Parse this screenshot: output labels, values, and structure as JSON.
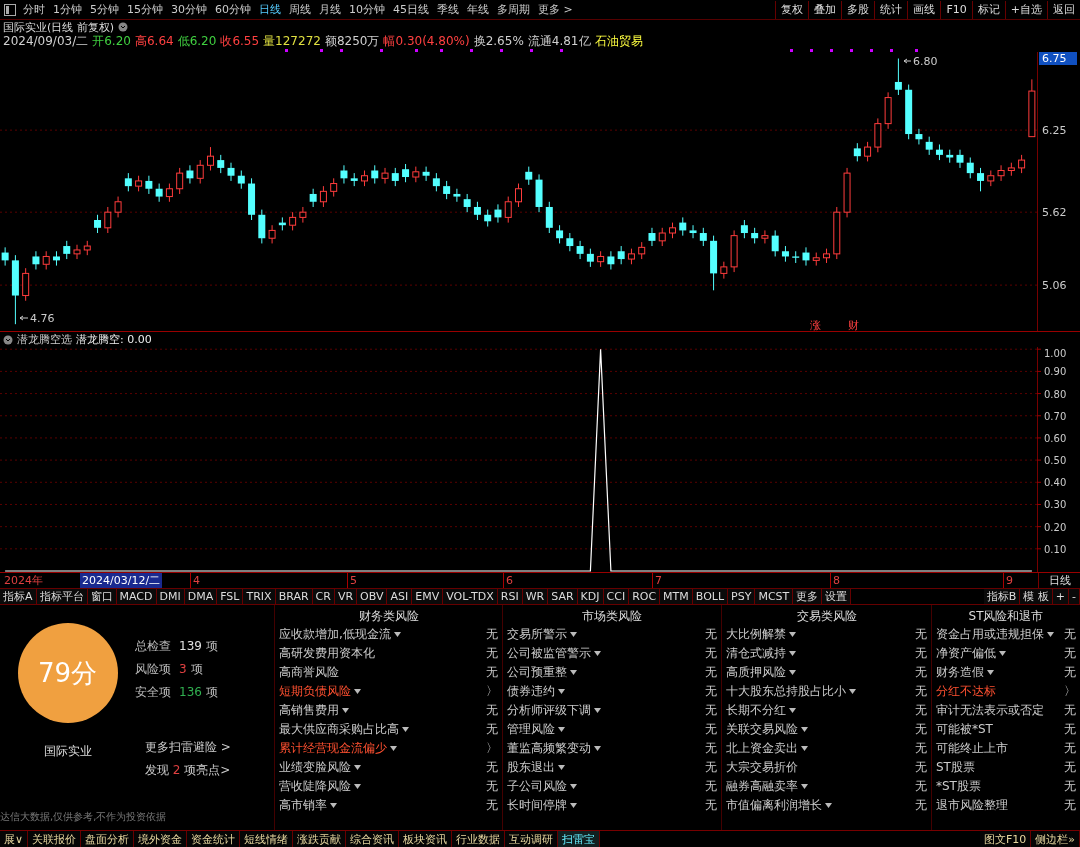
{
  "toolbar": {
    "periods": [
      {
        "label": "分时",
        "selected": false
      },
      {
        "label": "1分钟",
        "selected": false
      },
      {
        "label": "5分钟",
        "selected": false
      },
      {
        "label": "15分钟",
        "selected": false
      },
      {
        "label": "30分钟",
        "selected": false
      },
      {
        "label": "60分钟",
        "selected": false
      },
      {
        "label": "日线",
        "selected": true
      },
      {
        "label": "周线",
        "selected": false
      },
      {
        "label": "月线",
        "selected": false
      },
      {
        "label": "10分钟",
        "selected": false
      },
      {
        "label": "45日线",
        "selected": false
      },
      {
        "label": "季线",
        "selected": false
      },
      {
        "label": "年线",
        "selected": false
      },
      {
        "label": "多周期",
        "selected": false
      },
      {
        "label": "更多 >",
        "selected": false
      }
    ],
    "buttons": [
      "复权",
      "叠加",
      "多股",
      "统计",
      "画线",
      "F10",
      "标记",
      "+自选",
      "返回"
    ]
  },
  "stock": {
    "title": "国际实业(日线 前复权)",
    "quote": [
      {
        "text": "2024/09/03/二",
        "color": "#d0d0d0"
      },
      {
        "text": "开6.20",
        "color": "#40d040"
      },
      {
        "text": "高6.64",
        "color": "#ff4040"
      },
      {
        "text": "低6.20",
        "color": "#40d040"
      },
      {
        "text": "收6.55",
        "color": "#ff4040"
      },
      {
        "text": "量127272",
        "color": "#e0e040"
      },
      {
        "text": "额8250万",
        "color": "#d0d0d0"
      },
      {
        "text": "幅0.30(4.80%)",
        "color": "#ff4040"
      },
      {
        "text": "换2.65%",
        "color": "#d0d0d0"
      },
      {
        "text": "流通4.81亿",
        "color": "#d0d0d0"
      },
      {
        "text": "石油贸易",
        "color": "#ffff40"
      }
    ]
  },
  "price_chart": {
    "top_label": "6.75",
    "high_mark": "6.80",
    "low_mark": "4.76",
    "event_marks": [
      "涨",
      "财"
    ],
    "chart_data": {
      "type": "candlestick",
      "grid": true,
      "ylim": [
        4.7,
        6.85
      ],
      "yticks": [
        6.25,
        5.62,
        5.06
      ],
      "categories": [
        null,
        null,
        null,
        null,
        null,
        null,
        null,
        null,
        null,
        null,
        null,
        null,
        null,
        null,
        null,
        null,
        null,
        null,
        null,
        null,
        null,
        null,
        null,
        null,
        null,
        null,
        null,
        null,
        null,
        null,
        null,
        null,
        null,
        null,
        null,
        null,
        null,
        null,
        null,
        null,
        null,
        null,
        null,
        null,
        null,
        null,
        null,
        null,
        null,
        null,
        null,
        null,
        null,
        null,
        null,
        null,
        null,
        null,
        null,
        null,
        null,
        null,
        null,
        null,
        null,
        null,
        null,
        null,
        null,
        null,
        null,
        null,
        null,
        null,
        null,
        null,
        null,
        null,
        null,
        null,
        null,
        null,
        null,
        null,
        null,
        null,
        null,
        null,
        null,
        null,
        null,
        null,
        null,
        null,
        null,
        null,
        null,
        null,
        null,
        null,
        null
      ],
      "ohlc": [
        [
          5.31,
          5.35,
          5.21,
          5.25
        ],
        [
          5.25,
          5.29,
          4.76,
          4.98
        ],
        [
          4.98,
          5.19,
          4.94,
          5.15
        ],
        [
          5.28,
          5.32,
          5.18,
          5.22
        ],
        [
          5.22,
          5.32,
          5.18,
          5.28
        ],
        [
          5.28,
          5.32,
          5.21,
          5.25
        ],
        [
          5.36,
          5.4,
          5.26,
          5.3
        ],
        [
          5.3,
          5.37,
          5.26,
          5.33
        ],
        [
          5.33,
          5.4,
          5.29,
          5.36
        ],
        [
          5.56,
          5.6,
          5.46,
          5.5
        ],
        [
          5.5,
          5.66,
          5.46,
          5.62
        ],
        [
          5.62,
          5.74,
          5.58,
          5.7
        ],
        [
          5.88,
          5.92,
          5.78,
          5.82
        ],
        [
          5.82,
          5.9,
          5.78,
          5.86
        ],
        [
          5.86,
          5.9,
          5.76,
          5.8
        ],
        [
          5.8,
          5.84,
          5.7,
          5.74
        ],
        [
          5.74,
          5.84,
          5.7,
          5.8
        ],
        [
          5.8,
          5.96,
          5.76,
          5.92
        ],
        [
          5.94,
          5.98,
          5.84,
          5.88
        ],
        [
          5.88,
          6.02,
          5.84,
          5.98
        ],
        [
          5.98,
          6.12,
          5.94,
          6.05
        ],
        [
          6.02,
          6.06,
          5.92,
          5.96
        ],
        [
          5.96,
          6.0,
          5.86,
          5.9
        ],
        [
          5.9,
          5.94,
          5.8,
          5.84
        ],
        [
          5.84,
          5.88,
          5.56,
          5.6
        ],
        [
          5.6,
          5.64,
          5.38,
          5.42
        ],
        [
          5.42,
          5.52,
          5.38,
          5.48
        ],
        [
          5.54,
          5.58,
          5.48,
          5.52
        ],
        [
          5.52,
          5.62,
          5.48,
          5.58
        ],
        [
          5.58,
          5.66,
          5.54,
          5.62
        ],
        [
          5.76,
          5.8,
          5.66,
          5.7
        ],
        [
          5.7,
          5.82,
          5.66,
          5.78
        ],
        [
          5.78,
          5.88,
          5.74,
          5.84
        ],
        [
          5.94,
          5.98,
          5.84,
          5.88
        ],
        [
          5.88,
          5.92,
          5.82,
          5.86
        ],
        [
          5.86,
          5.94,
          5.82,
          5.9
        ],
        [
          5.94,
          5.98,
          5.84,
          5.88
        ],
        [
          5.88,
          5.96,
          5.84,
          5.92
        ],
        [
          5.92,
          5.96,
          5.82,
          5.86
        ],
        [
          5.95,
          5.99,
          5.85,
          5.89
        ],
        [
          5.89,
          5.97,
          5.85,
          5.93
        ],
        [
          5.93,
          5.97,
          5.86,
          5.9
        ],
        [
          5.88,
          5.92,
          5.78,
          5.82
        ],
        [
          5.82,
          5.86,
          5.72,
          5.76
        ],
        [
          5.76,
          5.8,
          5.7,
          5.74
        ],
        [
          5.72,
          5.76,
          5.62,
          5.66
        ],
        [
          5.66,
          5.7,
          5.56,
          5.6
        ],
        [
          5.6,
          5.64,
          5.51,
          5.55
        ],
        [
          5.64,
          5.68,
          5.54,
          5.58
        ],
        [
          5.58,
          5.74,
          5.54,
          5.7
        ],
        [
          5.7,
          5.84,
          5.66,
          5.8
        ],
        [
          5.93,
          5.97,
          5.83,
          5.87
        ],
        [
          5.87,
          5.91,
          5.62,
          5.66
        ],
        [
          5.66,
          5.7,
          5.46,
          5.5
        ],
        [
          5.48,
          5.52,
          5.38,
          5.42
        ],
        [
          5.42,
          5.46,
          5.32,
          5.36
        ],
        [
          5.36,
          5.4,
          5.26,
          5.3
        ],
        [
          5.3,
          5.34,
          5.2,
          5.24
        ],
        [
          5.24,
          5.32,
          5.2,
          5.28
        ],
        [
          5.28,
          5.32,
          5.18,
          5.22
        ],
        [
          5.32,
          5.36,
          5.22,
          5.26
        ],
        [
          5.26,
          5.34,
          5.22,
          5.3
        ],
        [
          5.3,
          5.39,
          5.26,
          5.35
        ],
        [
          5.46,
          5.5,
          5.36,
          5.4
        ],
        [
          5.4,
          5.5,
          5.36,
          5.46
        ],
        [
          5.46,
          5.54,
          5.42,
          5.5
        ],
        [
          5.54,
          5.58,
          5.44,
          5.48
        ],
        [
          5.48,
          5.52,
          5.42,
          5.46
        ],
        [
          5.46,
          5.5,
          5.36,
          5.4
        ],
        [
          5.4,
          5.44,
          5.02,
          5.15
        ],
        [
          5.15,
          5.24,
          5.11,
          5.2
        ],
        [
          5.2,
          5.48,
          5.16,
          5.44
        ],
        [
          5.52,
          5.56,
          5.42,
          5.46
        ],
        [
          5.46,
          5.5,
          5.38,
          5.42
        ],
        [
          5.42,
          5.48,
          5.38,
          5.44
        ],
        [
          5.44,
          5.48,
          5.28,
          5.32
        ],
        [
          5.32,
          5.36,
          5.24,
          5.28
        ],
        [
          5.28,
          5.32,
          5.23,
          5.27
        ],
        [
          5.31,
          5.35,
          5.21,
          5.25
        ],
        [
          5.25,
          5.31,
          5.21,
          5.27
        ],
        [
          5.27,
          5.34,
          5.23,
          5.3
        ],
        [
          5.3,
          5.66,
          5.26,
          5.62
        ],
        [
          5.62,
          5.96,
          5.58,
          5.92
        ],
        [
          6.11,
          6.15,
          6.01,
          6.05
        ],
        [
          6.05,
          6.16,
          6.01,
          6.12
        ],
        [
          6.12,
          6.34,
          6.08,
          6.3
        ],
        [
          6.3,
          6.54,
          6.26,
          6.5
        ],
        [
          6.62,
          6.8,
          6.52,
          6.56
        ],
        [
          6.56,
          6.6,
          6.18,
          6.22
        ],
        [
          6.22,
          6.26,
          6.14,
          6.18
        ],
        [
          6.16,
          6.2,
          6.06,
          6.1
        ],
        [
          6.1,
          6.14,
          6.02,
          6.06
        ],
        [
          6.06,
          6.1,
          6.0,
          6.04
        ],
        [
          6.06,
          6.1,
          5.96,
          6.0
        ],
        [
          6.0,
          6.04,
          5.88,
          5.92
        ],
        [
          5.92,
          5.96,
          5.78,
          5.86
        ],
        [
          5.86,
          5.94,
          5.82,
          5.9
        ],
        [
          5.9,
          5.98,
          5.86,
          5.94
        ],
        [
          5.94,
          6.0,
          5.9,
          5.96
        ],
        [
          5.96,
          6.06,
          5.92,
          6.02
        ],
        [
          6.2,
          6.64,
          6.2,
          6.55
        ]
      ]
    }
  },
  "indicator": {
    "name": "潜龙腾空选",
    "reading": ": 0.00",
    "chart_data": {
      "type": "line",
      "grid": true,
      "categories": [
        null,
        null,
        null,
        null,
        null,
        null,
        null,
        null,
        null,
        null,
        null,
        null,
        null,
        null,
        null,
        null,
        null,
        null,
        null,
        null,
        null,
        null,
        null,
        null,
        null,
        null,
        null,
        null,
        null,
        null,
        null,
        null,
        null,
        null,
        null,
        null,
        null,
        null,
        null,
        null,
        null,
        null,
        null,
        null,
        null,
        null,
        null,
        null,
        null,
        null,
        null,
        null,
        null,
        null,
        null,
        null,
        null,
        null,
        null,
        null,
        null,
        null,
        null,
        null,
        null,
        null,
        null,
        null,
        null,
        null,
        null,
        null,
        null,
        null,
        null,
        null,
        null,
        null,
        null,
        null,
        null,
        null,
        null,
        null,
        null,
        null,
        null,
        null,
        null,
        null,
        null,
        null,
        null,
        null,
        null,
        null,
        null,
        null,
        null,
        null,
        null
      ],
      "series": [
        {
          "name": "潜龙腾空",
          "color": "#ffffff",
          "values": [
            0,
            0,
            0,
            0,
            0,
            0,
            0,
            0,
            0,
            0,
            0,
            0,
            0,
            0,
            0,
            0,
            0,
            0,
            0,
            0,
            0,
            0,
            0,
            0,
            0,
            0,
            0,
            0,
            0,
            0,
            0,
            0,
            0,
            0,
            0,
            0,
            0,
            0,
            0,
            0,
            0,
            0,
            0,
            0,
            0,
            0,
            0,
            0,
            0,
            0,
            0,
            0,
            0,
            0,
            0,
            0,
            0,
            0,
            1,
            0,
            0,
            0,
            0,
            0,
            0,
            0,
            0,
            0,
            0,
            0,
            0,
            0,
            0,
            0,
            0,
            0,
            0,
            0,
            0,
            0,
            0,
            0,
            0,
            0,
            0,
            0,
            0,
            0,
            0,
            0,
            0,
            0,
            0,
            0,
            0,
            0,
            0,
            0,
            0,
            0,
            0
          ]
        }
      ],
      "ylim": [
        0,
        1.01
      ],
      "yticks": [
        {
          "value": 1,
          "label": "1.00"
        },
        {
          "value": 0.9,
          "label": "0.90"
        },
        {
          "value": 0.8,
          "label": "0.80"
        },
        {
          "value": 0.7,
          "label": "0.70"
        },
        {
          "value": 0.6,
          "label": "0.60"
        },
        {
          "value": 0.5,
          "label": "0.50"
        },
        {
          "value": 0.4,
          "label": "0.40"
        },
        {
          "value": 0.3,
          "label": "0.30"
        },
        {
          "value": 0.2,
          "label": "0.20"
        },
        {
          "value": 0.1,
          "label": "0.10"
        }
      ]
    }
  },
  "date_axis": {
    "labels": [
      {
        "text": "2024年",
        "kind": "year"
      },
      {
        "text": "2024/03/12/二",
        "kind": "cursor"
      },
      {
        "text": "4",
        "kind": "month"
      },
      {
        "text": "5",
        "kind": "month"
      },
      {
        "text": "6",
        "kind": "month"
      },
      {
        "text": "7",
        "kind": "month"
      },
      {
        "text": "8",
        "kind": "month"
      },
      {
        "text": "9",
        "kind": "month"
      }
    ],
    "period": "日线"
  },
  "indicator_tabs": {
    "items": [
      "指标A",
      "指标平台",
      "窗口",
      "MACD",
      "DMI",
      "DMA",
      "FSL",
      "TRIX",
      "BRAR",
      "CR",
      "VR",
      "OBV",
      "ASI",
      "EMV",
      "VOL-TDX",
      "RSI",
      "WR",
      "SAR",
      "KDJ",
      "CCI",
      "ROC",
      "MTM",
      "BOLL",
      "PSY",
      "MCST",
      "更多",
      "设置"
    ],
    "right": [
      "指标B",
      "模 板",
      "+",
      "-"
    ]
  },
  "risk_scan": {
    "score": "79分",
    "stock_name": "国际实业",
    "stats": [
      {
        "label": "总检查",
        "value": "139",
        "unit": "项",
        "color": "#e0e0e0"
      },
      {
        "label": "风险项",
        "value": "3",
        "unit": "项",
        "color": "#e04040"
      },
      {
        "label": "安全项",
        "value": "136",
        "unit": "项",
        "color": "#30b050"
      }
    ],
    "more_link": "更多扫雷避险 >",
    "highlights": {
      "prefix": "发现",
      "count": "2",
      "suffix": "项亮点>"
    },
    "disclaimer": "达信大数据,仅供参考,不作为投资依据",
    "columns": [
      {
        "title": "财务类风险",
        "items": [
          {
            "label": "应收款增加,低现金流",
            "menu": true,
            "risk": false,
            "result": "无"
          },
          {
            "label": "高研发费用资本化",
            "menu": false,
            "risk": false,
            "result": "无"
          },
          {
            "label": "高商誉风险",
            "menu": false,
            "risk": false,
            "result": "无"
          },
          {
            "label": "短期负债风险",
            "menu": true,
            "risk": true,
            "result": "〉"
          },
          {
            "label": "高销售费用",
            "menu": true,
            "risk": false,
            "result": "无"
          },
          {
            "label": "最大供应商采购占比高",
            "menu": true,
            "risk": false,
            "result": "无"
          },
          {
            "label": "累计经营现金流偏少",
            "menu": true,
            "risk": true,
            "result": "〉"
          },
          {
            "label": "业绩变脸风险",
            "menu": true,
            "risk": false,
            "result": "无"
          },
          {
            "label": "营收陡降风险",
            "menu": true,
            "risk": false,
            "result": "无"
          },
          {
            "label": "高市销率",
            "menu": true,
            "risk": false,
            "result": "无"
          }
        ]
      },
      {
        "title": "市场类风险",
        "items": [
          {
            "label": "交易所警示",
            "menu": true,
            "risk": false,
            "result": "无"
          },
          {
            "label": "公司被监管警示",
            "menu": true,
            "risk": false,
            "result": "无"
          },
          {
            "label": "公司预重整",
            "menu": true,
            "risk": false,
            "result": "无"
          },
          {
            "label": "债券违约",
            "menu": true,
            "risk": false,
            "result": "无"
          },
          {
            "label": "分析师评级下调",
            "menu": true,
            "risk": false,
            "result": "无"
          },
          {
            "label": "管理风险",
            "menu": true,
            "risk": false,
            "result": "无"
          },
          {
            "label": "董监高频繁变动",
            "menu": true,
            "risk": false,
            "result": "无"
          },
          {
            "label": "股东退出",
            "menu": true,
            "risk": false,
            "result": "无"
          },
          {
            "label": "子公司风险",
            "menu": true,
            "risk": false,
            "result": "无"
          },
          {
            "label": "长时间停牌",
            "menu": true,
            "risk": false,
            "result": "无"
          }
        ]
      },
      {
        "title": "交易类风险",
        "items": [
          {
            "label": "大比例解禁",
            "menu": true,
            "risk": false,
            "result": "无"
          },
          {
            "label": "清仓式减持",
            "menu": true,
            "risk": false,
            "result": "无"
          },
          {
            "label": "高质押风险",
            "menu": true,
            "risk": false,
            "result": "无"
          },
          {
            "label": "十大股东总持股占比小",
            "menu": true,
            "risk": false,
            "result": "无"
          },
          {
            "label": "长期不分红",
            "menu": true,
            "risk": false,
            "result": "无"
          },
          {
            "label": "关联交易风险",
            "menu": true,
            "risk": false,
            "result": "无"
          },
          {
            "label": "北上资金卖出",
            "menu": true,
            "risk": false,
            "result": "无"
          },
          {
            "label": "大宗交易折价",
            "menu": false,
            "risk": false,
            "result": "无"
          },
          {
            "label": "融券高融卖率",
            "menu": true,
            "risk": false,
            "result": "无"
          },
          {
            "label": "市值偏离利润增长",
            "menu": true,
            "risk": false,
            "result": "无"
          }
        ]
      },
      {
        "title": "ST风险和退市",
        "items": [
          {
            "label": "资金占用或违规担保",
            "menu": true,
            "risk": false,
            "result": "无"
          },
          {
            "label": "净资产偏低",
            "menu": true,
            "risk": false,
            "result": "无"
          },
          {
            "label": "财务造假",
            "menu": true,
            "risk": false,
            "result": "无"
          },
          {
            "label": "分红不达标",
            "menu": false,
            "risk": true,
            "result": "〉"
          },
          {
            "label": "审计无法表示或否定",
            "menu": false,
            "risk": false,
            "result": "无"
          },
          {
            "label": "可能被*ST",
            "menu": false,
            "risk": false,
            "result": "无"
          },
          {
            "label": "可能终止上市",
            "menu": false,
            "risk": false,
            "result": "无"
          },
          {
            "label": "ST股票",
            "menu": false,
            "risk": false,
            "result": "无"
          },
          {
            "label": "*ST股票",
            "menu": false,
            "risk": false,
            "result": "无"
          },
          {
            "label": "退市风险整理",
            "menu": false,
            "risk": false,
            "result": "无"
          }
        ]
      }
    ]
  },
  "bottom_tabs": {
    "items": [
      {
        "label": "展∨",
        "selected": false
      },
      {
        "label": "关联报价",
        "selected": false
      },
      {
        "label": "盘面分析",
        "selected": false
      },
      {
        "label": "境外资金",
        "selected": false
      },
      {
        "label": "资金统计",
        "selected": false
      },
      {
        "label": "短线情绪",
        "selected": false
      },
      {
        "label": "涨跌贡献",
        "selected": false
      },
      {
        "label": "综合资讯",
        "selected": false
      },
      {
        "label": "板块资讯",
        "selected": false
      },
      {
        "label": "行业数据",
        "selected": false
      },
      {
        "label": "互动调研",
        "selected": false
      },
      {
        "label": "扫雷宝",
        "selected": true
      }
    ],
    "right": [
      "图文F10",
      "侧边栏»"
    ]
  }
}
